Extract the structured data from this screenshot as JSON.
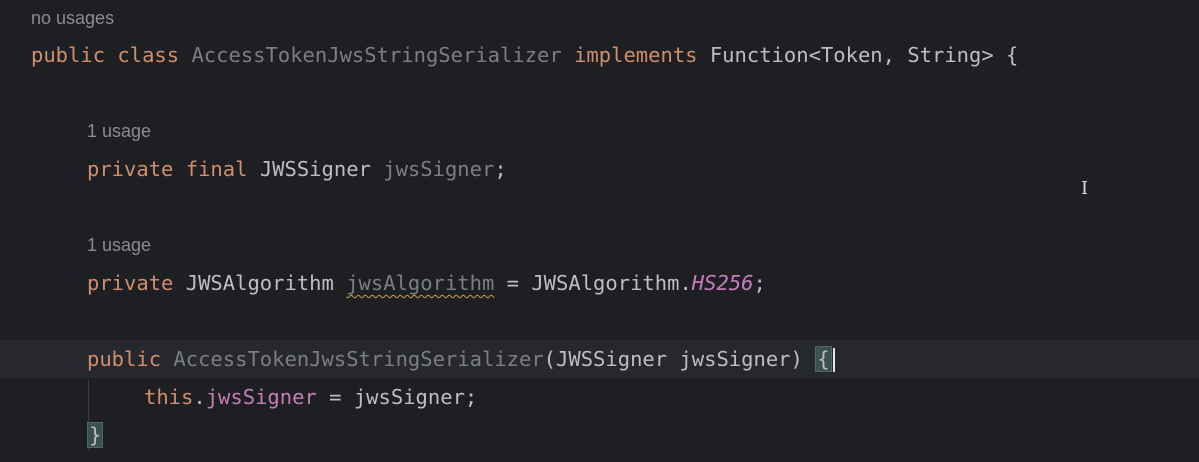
{
  "hints": {
    "class_usages": "no usages",
    "field1_usages": "1 usage",
    "field2_usages": "1 usage"
  },
  "code": {
    "line1": {
      "kw_public": "public",
      "kw_class": "class",
      "class_name": "AccessTokenJwsStringSerializer",
      "kw_implements": "implements",
      "type": "Function<Token, String> {"
    },
    "line2": {
      "kw_private": "private",
      "kw_final": "final",
      "type": "JWSSigner",
      "field": "jwsSigner",
      "end": ";"
    },
    "line3": {
      "kw_private": "private",
      "type": "JWSAlgorithm",
      "field": "jwsAlgorithm",
      "assign": " = JWSAlgorithm.",
      "const": "HS256",
      "end": ";"
    },
    "line4": {
      "kw_public": "public",
      "ctor_name": "AccessTokenJwsStringSerializer",
      "params": "(JWSSigner jwsSigner) ",
      "brace": "{"
    },
    "line5": {
      "kw_this": "this",
      "dot": ".",
      "field": "jwsSigner",
      "rest": " = jwsSigner;"
    },
    "line6": {
      "brace": "}"
    }
  },
  "colors": {
    "background": "#1e1f22",
    "keyword": "#cf8e6d",
    "field": "#c77dbb",
    "unused": "#7b7e84",
    "text": "#bcbec4"
  },
  "cursor": "text-cursor-icon"
}
